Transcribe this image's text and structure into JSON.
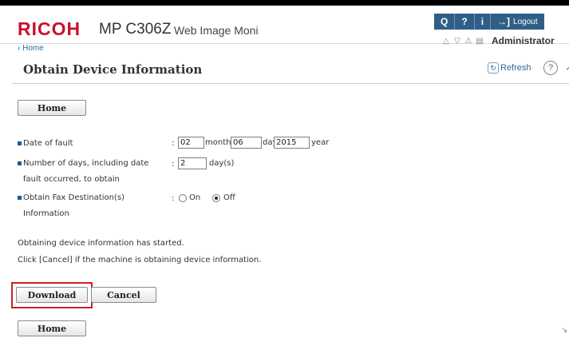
{
  "header": {
    "logo": "RICOH",
    "model": "MP C306Z",
    "app_title": "Web Image Moni",
    "toolbar": {
      "search_glyph": "Q",
      "help_glyph": "?",
      "info_glyph": "i",
      "logout_glyph": "→]",
      "logout_label": "Logout"
    },
    "user": "Administrator"
  },
  "breadcrumb": "Home",
  "page": {
    "title": "Obtain Device Information",
    "refresh": "Refresh",
    "help_glyph": "?"
  },
  "buttons": {
    "home": "Home",
    "download": "Download",
    "cancel": "Cancel"
  },
  "form": {
    "date_label": "Date of fault",
    "month_value": "02",
    "month_unit": "month",
    "day_value": "06",
    "day_unit": "day",
    "year_value": "2015",
    "year_unit": "year",
    "days_label_line1": "Number of days, including date",
    "days_label_line2": "fault occurred, to obtain",
    "days_value": "2",
    "days_unit": "day(s)",
    "fax_label_line1": "Obtain Fax Destination(s)",
    "fax_label_line2": "Information",
    "fax_on": "On",
    "fax_off": "Off",
    "fax_selected": "Off"
  },
  "messages": {
    "line1": "Obtaining device information has started.",
    "line2": "Click [Cancel] if the machine is obtaining device information."
  }
}
